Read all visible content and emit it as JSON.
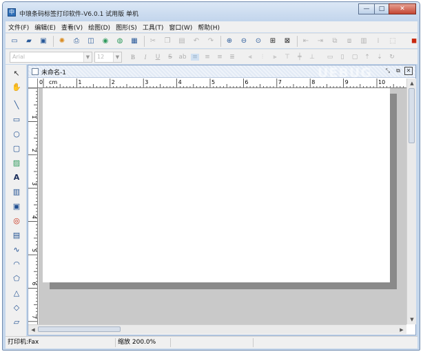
{
  "window": {
    "title": "中琅条码标签打印软件-V6.0.1 试用版 单机",
    "app_icon": "app-logo-icon",
    "controls": {
      "minimize": "—",
      "maximize": "□",
      "close": "✕"
    }
  },
  "menubar": {
    "items": [
      {
        "label": "文件(F)"
      },
      {
        "label": "编辑(E)"
      },
      {
        "label": "查看(V)"
      },
      {
        "label": "绘图(D)"
      },
      {
        "label": "图形(S)"
      },
      {
        "label": "工具(T)"
      },
      {
        "label": "窗口(W)"
      },
      {
        "label": "帮助(H)"
      }
    ]
  },
  "toolbar": {
    "icons": [
      "new-icon",
      "open-icon",
      "save-icon",
      "database-icon",
      "print-icon",
      "print-preview-icon",
      "barcode-settings-icon",
      "data-source-icon",
      "grid-icon",
      "cut-icon",
      "copy-icon",
      "paste-icon",
      "undo-icon",
      "redo-icon",
      "zoom-in-icon",
      "zoom-out-icon",
      "zoom-fit-icon",
      "zoom-page-icon",
      "zoom-actual-icon",
      "align-left-icon",
      "align-right-icon",
      "group-icon",
      "ungroup-icon",
      "lock-icon",
      "distribute-icon",
      "pdf-icon"
    ]
  },
  "format_bar": {
    "font_name": "Arial",
    "font_size": "12",
    "bold": "B",
    "italic": "I",
    "underline": "U",
    "strike": "S",
    "superscript": "ab"
  },
  "left_tools": [
    "select-pointer-icon",
    "hand-icon",
    "line-icon",
    "rectangle-icon",
    "ellipse-icon",
    "rounded-rect-icon",
    "image-icon",
    "text-icon",
    "barcode-icon",
    "qrcode-icon",
    "stamp-icon",
    "ocr-text-icon",
    "curve-icon",
    "arc-icon",
    "polygon-icon",
    "triangle-icon",
    "diamond-icon",
    "parallelogram-icon"
  ],
  "document": {
    "tab_title": "未命名-1",
    "watermark": "UEBUG",
    "ruler_unit": "cm",
    "hruler_labels": [
      "0",
      "1",
      "2",
      "3",
      "4",
      "5",
      "6",
      "7",
      "8",
      "9",
      "10"
    ],
    "vruler_labels": [
      "1",
      "2",
      "3",
      "4",
      "5",
      "6",
      "7"
    ]
  },
  "statusbar": {
    "printer": "打印机:Fax",
    "zoom": "缩放 200.0%"
  },
  "colors": {
    "window_frame": "#c5d7ec",
    "menu_bg": "#f0f0f0",
    "canvas_bg": "#c9c9c9",
    "page_shadow": "#8a8a8a",
    "close_button": "#c44633"
  }
}
